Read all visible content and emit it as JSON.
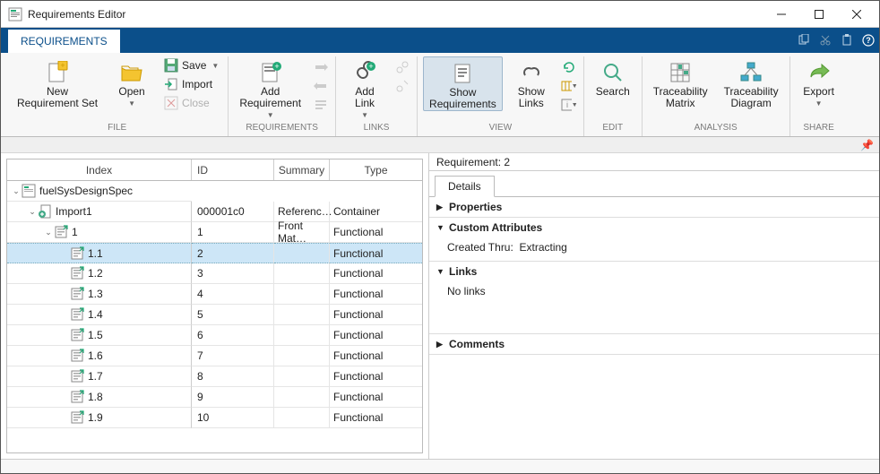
{
  "window": {
    "title": "Requirements Editor"
  },
  "tabs": {
    "active": "REQUIREMENTS"
  },
  "ribbon": {
    "groups": {
      "file": {
        "label": "FILE",
        "new": "New\nRequirement Set",
        "open": "Open",
        "save": "Save",
        "import": "Import",
        "close": "Close"
      },
      "requirements": {
        "label": "REQUIREMENTS",
        "add": "Add\nRequirement"
      },
      "links": {
        "label": "LINKS",
        "add": "Add\nLink"
      },
      "view": {
        "label": "VIEW",
        "showreq": "Show\nRequirements",
        "showlinks": "Show\nLinks"
      },
      "edit": {
        "label": "EDIT",
        "search": "Search"
      },
      "analysis": {
        "label": "ANALYSIS",
        "matrix": "Traceability\nMatrix",
        "diagram": "Traceability\nDiagram"
      },
      "share": {
        "label": "SHARE",
        "export": "Export"
      }
    }
  },
  "tree": {
    "headers": {
      "index": "Index",
      "id": "ID",
      "summary": "Summary",
      "type": "Type"
    },
    "rows": [
      {
        "level": 0,
        "expand": "open",
        "icon": "reqset",
        "index": "fuelSysDesignSpec",
        "id": "",
        "summary": "",
        "type": ""
      },
      {
        "level": 1,
        "expand": "open",
        "icon": "import",
        "index": "Import1",
        "id": "000001c0",
        "summary": "Referenc…",
        "type": "Container"
      },
      {
        "level": 2,
        "expand": "open",
        "icon": "req",
        "index": "1",
        "id": "1",
        "summary": "Front Mat…",
        "type": "Functional"
      },
      {
        "level": 3,
        "expand": "none",
        "icon": "req",
        "index": "1.1",
        "id": "2",
        "summary": "",
        "type": "Functional",
        "selected": true
      },
      {
        "level": 3,
        "expand": "none",
        "icon": "req",
        "index": "1.2",
        "id": "3",
        "summary": "",
        "type": "Functional"
      },
      {
        "level": 3,
        "expand": "none",
        "icon": "req",
        "index": "1.3",
        "id": "4",
        "summary": "",
        "type": "Functional"
      },
      {
        "level": 3,
        "expand": "none",
        "icon": "req",
        "index": "1.4",
        "id": "5",
        "summary": "",
        "type": "Functional"
      },
      {
        "level": 3,
        "expand": "none",
        "icon": "req",
        "index": "1.5",
        "id": "6",
        "summary": "",
        "type": "Functional"
      },
      {
        "level": 3,
        "expand": "none",
        "icon": "req",
        "index": "1.6",
        "id": "7",
        "summary": "",
        "type": "Functional"
      },
      {
        "level": 3,
        "expand": "none",
        "icon": "req",
        "index": "1.7",
        "id": "8",
        "summary": "",
        "type": "Functional"
      },
      {
        "level": 3,
        "expand": "none",
        "icon": "req",
        "index": "1.8",
        "id": "9",
        "summary": "",
        "type": "Functional"
      },
      {
        "level": 3,
        "expand": "none",
        "icon": "req",
        "index": "1.9",
        "id": "10",
        "summary": "",
        "type": "Functional"
      }
    ]
  },
  "details": {
    "title": "Requirement: 2",
    "tab": "Details",
    "sections": {
      "properties": {
        "label": "Properties",
        "open": false
      },
      "custom": {
        "label": "Custom Attributes",
        "open": true,
        "created_label": "Created Thru:",
        "created_value": "Extracting"
      },
      "links": {
        "label": "Links",
        "open": true,
        "empty": "No links"
      },
      "comments": {
        "label": "Comments",
        "open": false
      }
    }
  }
}
